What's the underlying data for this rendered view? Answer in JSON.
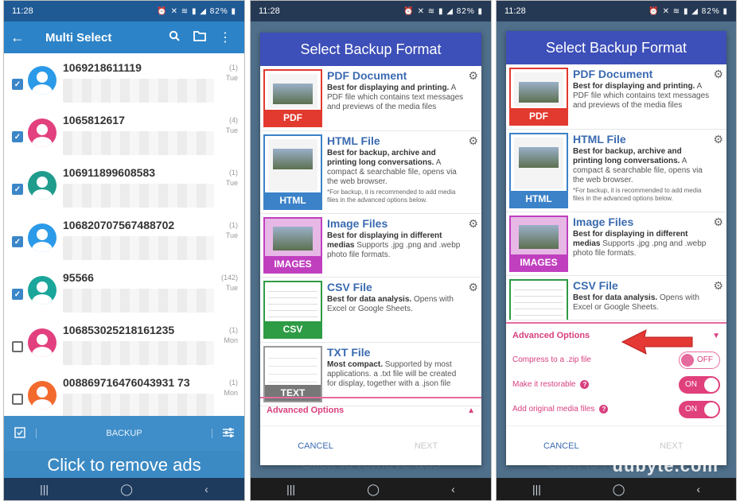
{
  "status": {
    "time": "11:28",
    "icons": "⏰ ✕ ≋ ▮ ◢ 82% ▮",
    "battery": "82%"
  },
  "panel1": {
    "title": "Multi Select",
    "conversations": [
      {
        "number": "1069218611119",
        "count": "(1)",
        "day": "Tue",
        "checked": true,
        "color": "#2b9ae8"
      },
      {
        "number": "1065812617",
        "count": "(4)",
        "day": "Tue",
        "checked": true,
        "color": "#e2407e"
      },
      {
        "number": "106911899608583",
        "count": "(1)",
        "day": "Tue",
        "checked": true,
        "color": "#1f9c8c"
      },
      {
        "number": "106820707567488702",
        "count": "(1)",
        "day": "Tue",
        "checked": true,
        "color": "#2b9ae8"
      },
      {
        "number": "95566",
        "count": "(142)",
        "day": "Tue",
        "checked": true,
        "color": "#1aa69a"
      },
      {
        "number": "106853025218161235",
        "count": "(1)",
        "day": "Mon",
        "checked": false,
        "color": "#e2407e"
      },
      {
        "number": "008869716476043931 73",
        "count": "(1)",
        "day": "Mon",
        "checked": false,
        "color": "#f26a2e"
      }
    ],
    "backup_label": "BACKUP",
    "ad_text": "Click to remove ads"
  },
  "dialog": {
    "title": "Select Backup Format",
    "formats": [
      {
        "name": "PDF Document",
        "bold": "Best for displaying and printing.",
        "desc": "A PDF file which contains text messages and previews of the media files",
        "note": "",
        "badge": "PDF",
        "badge_color": "#e23a2e"
      },
      {
        "name": "HTML File",
        "bold": "Best for backup, archive and printing long conversations.",
        "desc": "A compact & searchable file, opens via the web browser.",
        "note": "*For backup, it is recommended to add media files in the advanced options below.",
        "badge": "HTML",
        "badge_color": "#3b82c8"
      },
      {
        "name": "Image Files",
        "bold": "Best for displaying in different medias",
        "desc": "Supports .jpg .png and .webp photo file formats.",
        "note": "",
        "badge": "IMAGES",
        "badge_color": "#c03fbf"
      },
      {
        "name": "CSV File",
        "bold": "Best for data analysis.",
        "desc": "Opens with Excel or Google Sheets.",
        "note": "",
        "badge": "CSV",
        "badge_color": "#2e9b45"
      },
      {
        "name": "TXT File",
        "bold": "Most compact.",
        "desc": "Supported by most applications. a .txt file will be created for display, together with a .json file",
        "note": "",
        "badge": "TEXT",
        "badge_color": "#777777"
      }
    ],
    "advanced_label": "Advanced Options",
    "cancel": "CANCEL",
    "next": "NEXT"
  },
  "panel2": {
    "ghost_text": "Click to remove ads"
  },
  "panel3": {
    "options": [
      {
        "label": "Compress to a .zip file",
        "help": false,
        "state": "OFF"
      },
      {
        "label": "Make it restorable",
        "help": true,
        "state": "ON"
      },
      {
        "label": "Add original media files",
        "help": true,
        "state": "ON"
      }
    ],
    "watermark": "uubyte.com"
  },
  "nav": {
    "recents": "|||",
    "home": "◯",
    "back": "‹"
  }
}
